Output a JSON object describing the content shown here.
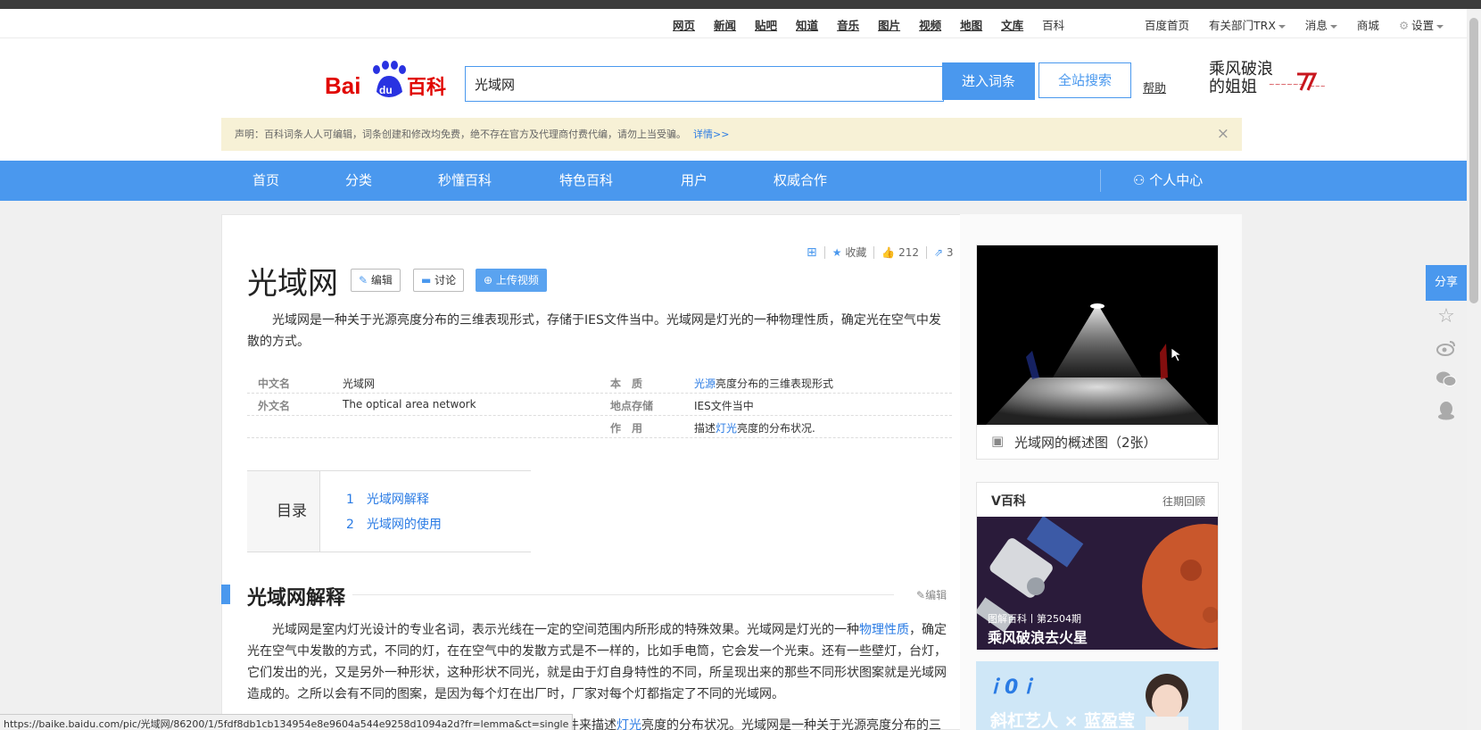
{
  "topbar": {
    "links": [
      "网页",
      "新闻",
      "贴吧",
      "知道",
      "音乐",
      "图片",
      "视频",
      "地图",
      "文库",
      "百科"
    ],
    "right": {
      "home": "百度首页",
      "dept": "有关部门TRX",
      "messages": "消息",
      "mall": "商城",
      "settings": "设置"
    }
  },
  "header": {
    "search_value": "光域网",
    "enter_button": "进入词条",
    "all_search_button": "全站搜索",
    "help": "帮助",
    "promo_line1": "乘风破浪",
    "promo_line2": "的姐姐"
  },
  "notice": {
    "text": "声明：百科词条人人可编辑，词条创建和修改均免费，绝不存在官方及代理商付费代编，请勿上当受骗。",
    "link": "详情>>",
    "close": "×"
  },
  "nav": {
    "items": [
      "首页",
      "分类",
      "秒懂百科",
      "特色百科",
      "用户",
      "权威合作"
    ],
    "user_center": "个人中心"
  },
  "actions": {
    "collect": "收藏",
    "likes": "212",
    "shares": "3"
  },
  "article": {
    "title": "光域网",
    "edit_button": "编辑",
    "discuss_button": "讨论",
    "upload_video_button": "上传视频",
    "summary": "光域网是一种关于光源亮度分布的三维表现形式，存储于IES文件当中。光域网是灯光的一种物理性质，确定光在空气中发散的方式。",
    "info": {
      "k1": "中文名",
      "v1": "光域网",
      "k2": "外文名",
      "v2": "The optical area network",
      "k3": "本　质",
      "v3_link": "光源",
      "v3_rest": "亮度分布的三维表现形式",
      "k4": "地点存储",
      "v4": "IES文件当中",
      "k5": "作　用",
      "v5_pre": "描述",
      "v5_link": "灯光",
      "v5_rest": "亮度的分布状况."
    },
    "toc": {
      "label": "目录",
      "items": [
        "1　光域网解释",
        "2　光域网的使用"
      ]
    },
    "section1": {
      "title": "光域网解释",
      "edit": "编辑",
      "text_a": "光域网是室内灯光设计的专业名词，表示光线在一定的空间范围内所形成的特殊效果。光域网是灯光的一种",
      "text_link": "物理性质",
      "text_b": "，确定光在空气中发散的方式，不同的灯，在在空气中的发散方式是不一样的，比如手电筒，它会发一个光束。还有一些壁灯，台灯，它们发出的光，又是另外一种形状，这种形状不同光，就是由于灯自身特性的不同，所呈现出来的那些不同形状图案就是光域网造成的。之所以会有不同的图案，是因为每个灯在出厂时，厂家对每个灯都指定了不同的光域网。",
      "text_tail_pre": "域网文件来描述",
      "text_tail_link": "灯光",
      "text_tail_rest": "亮度的分布状况。光域网是一种关于光源亮度分布的三"
    }
  },
  "sidebar": {
    "image_caption": "光域网的概述图（2张）",
    "vbaike_title": "V百科",
    "vbaike_more": "往期回顾",
    "vbaike_issue": "图解百科丨第2504期",
    "vbaike_headline": "乘风破浪去火星",
    "ad_text": "斜杠艺人 × 蓝盈莹"
  },
  "share": {
    "label": "分享"
  },
  "statusbar": {
    "url": "https://baike.baidu.com/pic/光域网/86200/1/5fdf8db1cb134954e8e9604a544e9258d1094a2d?fr=lemma&ct=single"
  },
  "colors": {
    "brand_blue": "#4a98ee",
    "link_blue": "#2a7be4",
    "notice_bg": "#f7f1d6"
  }
}
